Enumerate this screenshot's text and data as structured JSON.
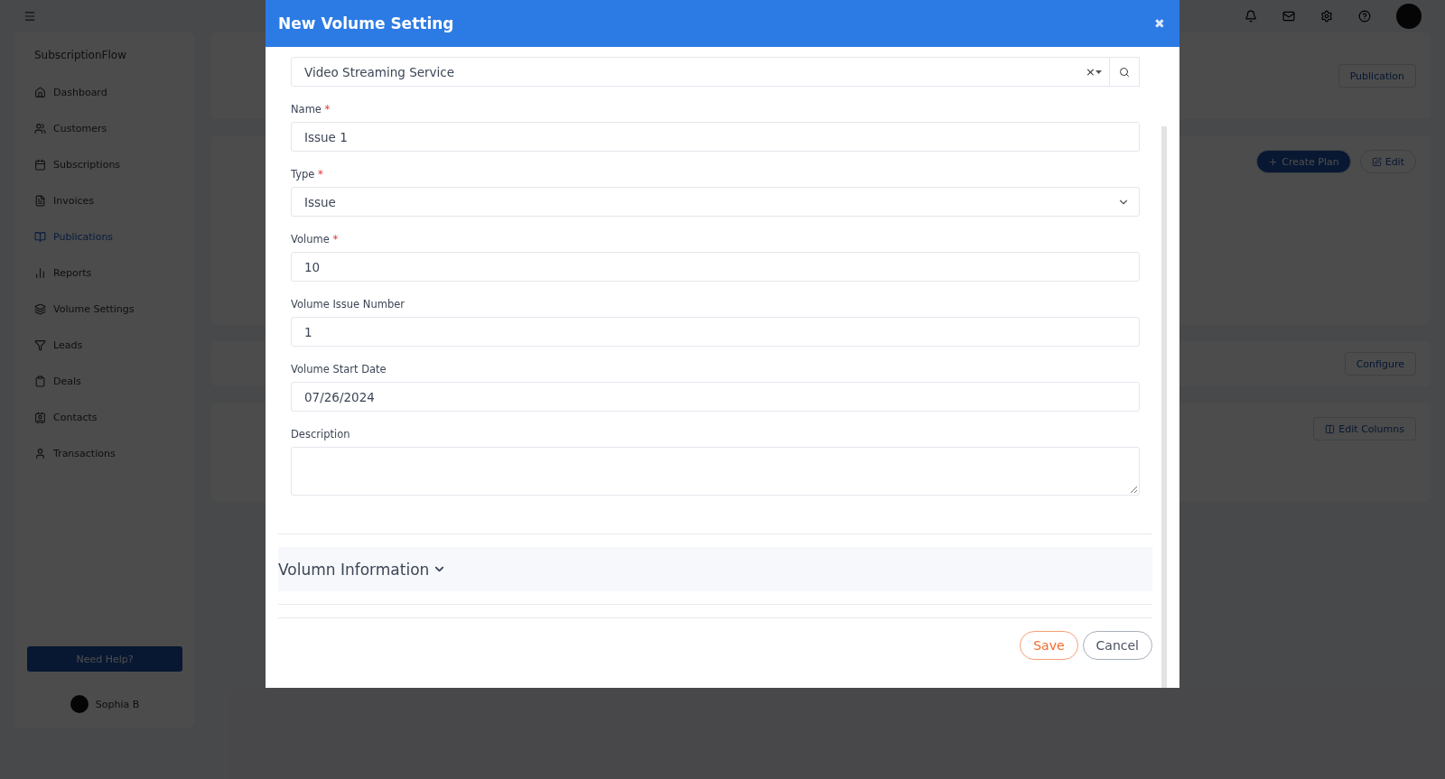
{
  "sidebar": {
    "brand": "SubscriptionFlow",
    "items": [
      {
        "label": "Dashboard",
        "selected": false
      },
      {
        "label": "Customers",
        "selected": false
      },
      {
        "label": "Subscriptions",
        "selected": false
      },
      {
        "label": "Invoices",
        "selected": false
      },
      {
        "label": "Publications",
        "selected": true
      },
      {
        "label": "Reports",
        "selected": false
      },
      {
        "label": "Volume Settings",
        "selected": false
      },
      {
        "label": "Leads",
        "selected": false
      },
      {
        "label": "Deals",
        "selected": false
      },
      {
        "label": "Contacts",
        "selected": false
      },
      {
        "label": "Transactions",
        "selected": false
      }
    ],
    "help_button": "Need Help?",
    "user": "Sophia B"
  },
  "main": {
    "breadcrumb_button": "Publication",
    "create_button": "Create Plan",
    "edit_button": "Edit",
    "configure_button": "Configure",
    "columns_button": "Edit Columns"
  },
  "modal": {
    "title": "New Volume Setting",
    "close": "✖",
    "required_mark": "*",
    "product": {
      "value": "Video Streaming Service",
      "clear": "×"
    },
    "fields": [
      {
        "label": "Name",
        "kind": "text",
        "required": true,
        "value": "Issue 1"
      },
      {
        "label": "Type",
        "kind": "select",
        "required": true,
        "value": "Issue"
      },
      {
        "label": "Volume",
        "kind": "text",
        "required": true,
        "value": "10"
      },
      {
        "label": "Volume Issue Number",
        "kind": "text",
        "required": false,
        "value": "1"
      },
      {
        "label": "Volume Start Date",
        "kind": "text",
        "required": false,
        "value": "07/26/2024"
      },
      {
        "label": "Description",
        "kind": "textarea",
        "required": false
      }
    ],
    "section": {
      "title": "Volumn Information",
      "expanded": false
    },
    "buttons": [
      {
        "label": "Save",
        "kind": "primary"
      },
      {
        "label": "Cancel",
        "kind": "secondary"
      }
    ]
  }
}
